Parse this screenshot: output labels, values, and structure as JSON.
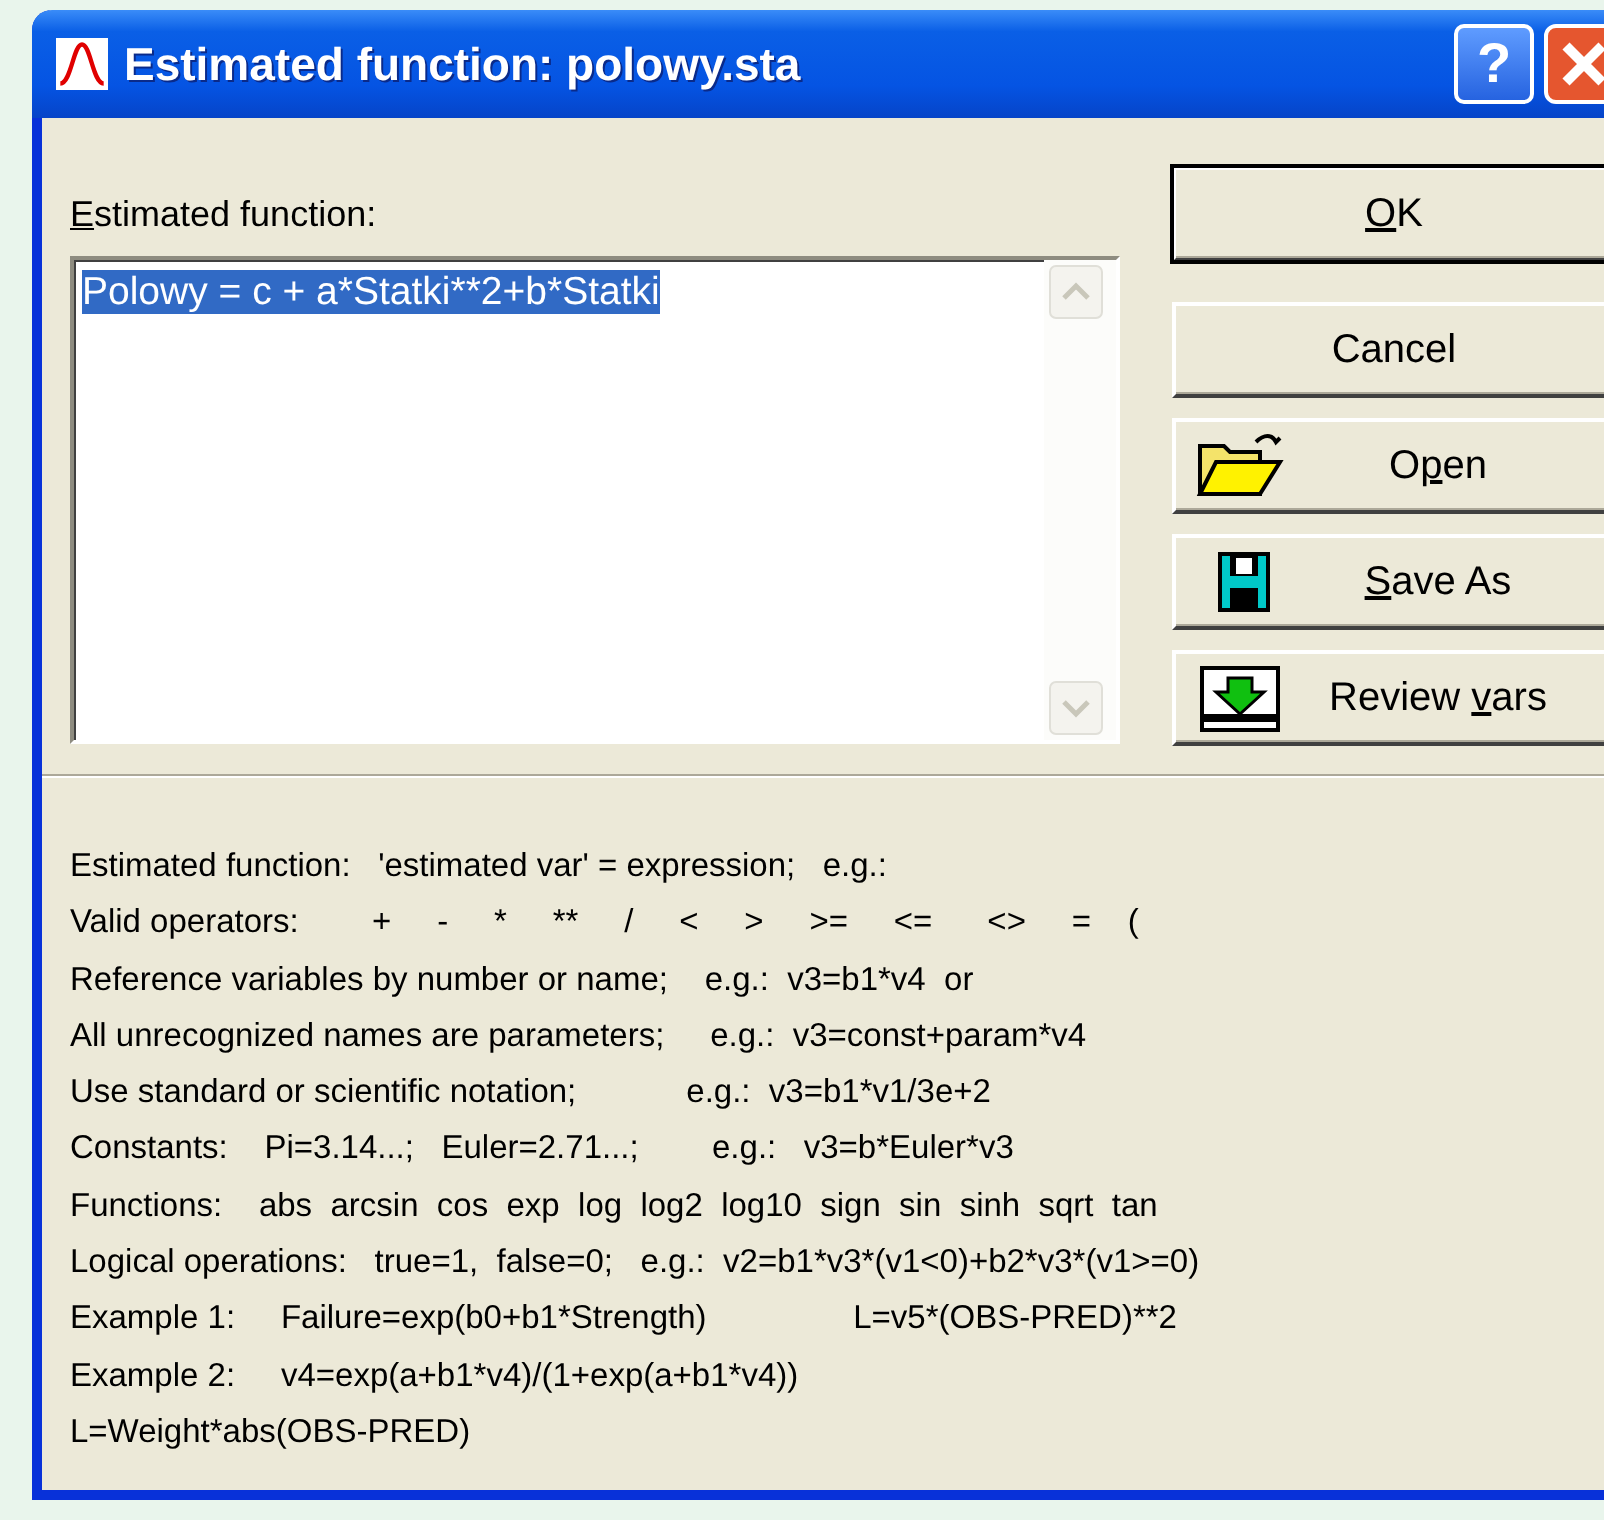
{
  "window": {
    "title": "Estimated function: polowy.sta",
    "help_button": "?"
  },
  "function_label": {
    "key": "E",
    "post": "stimated function:"
  },
  "function_field": {
    "value": "Polowy = c + a*Statki**2+b*Statki",
    "selected": true
  },
  "buttons": [
    {
      "kind": "plain",
      "key": "O",
      "post": "K",
      "default": true
    },
    {
      "kind": "plain",
      "pre": "Cancel",
      "default": false
    },
    {
      "kind": "open",
      "pre": "O",
      "key": "p",
      "post": "en",
      "default": false
    },
    {
      "kind": "save",
      "key": "S",
      "post": "ave As",
      "default": false
    },
    {
      "kind": "review",
      "pre": "Review ",
      "key": "v",
      "post": "ars",
      "default": false
    }
  ],
  "help_lines": [
    "Estimated function:   'estimated var' = expression;   e.g.:",
    "Valid operators:        +     -     *     **     /     <     >     >=     <=      <>     =    (",
    "Reference variables by number or name;    e.g.:  v3=b1*v4  or",
    "All unrecognized names are parameters;     e.g.:  v3=const+param*v4",
    "Use standard or scientific notation;            e.g.:  v3=b1*v1/3e+2",
    "Constants:    Pi=3.14...;   Euler=2.71...;        e.g.:   v3=b*Euler*v3",
    "Functions:    abs  arcsin  cos  exp  log  log2  log10  sign  sin  sinh  sqrt  tan",
    "Logical operations:   true=1,  false=0;   e.g.:  v2=b1*v3*(v1<0)+b2*v3*(v1>=0)",
    "Example 1:     Failure=exp(b0+b1*Strength)                L=v5*(OBS-PRED)**2",
    "Example 2:     v4=exp(a+b1*v4)/(1+exp(a+b1*v4))",
    "L=Weight*abs(OBS-PRED)"
  ]
}
